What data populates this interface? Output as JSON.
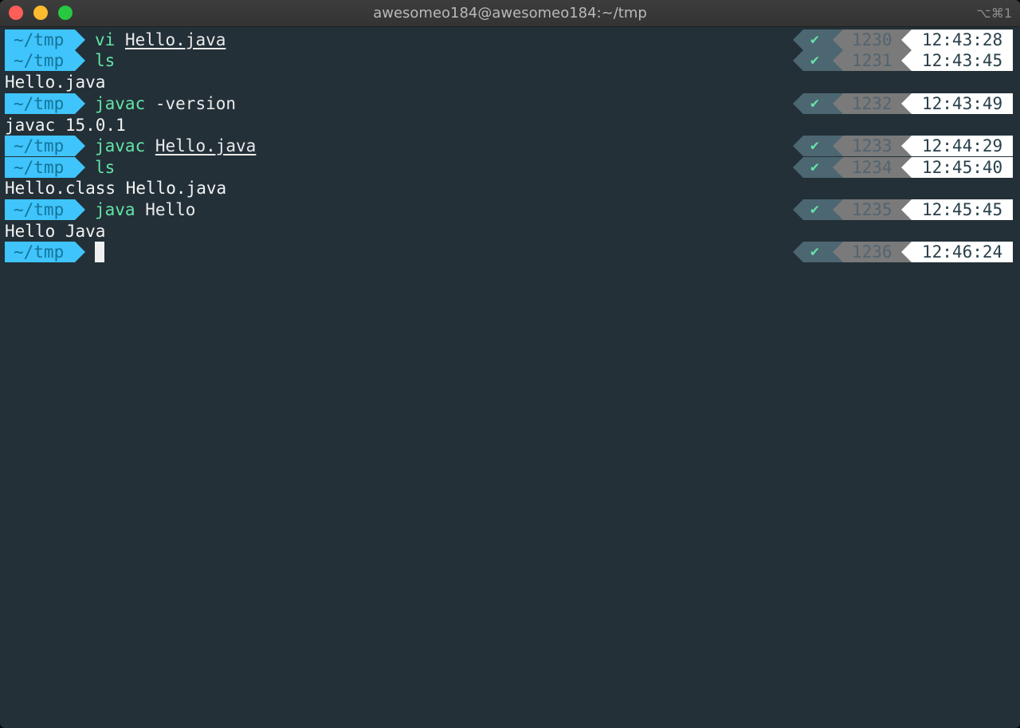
{
  "window": {
    "title": "awesomeo184@awesomeo184:~/tmp",
    "shortcut": "⌥⌘1"
  },
  "terminal": {
    "prompt_dir": "~/tmp",
    "status_mark": "✔",
    "entries": [
      {
        "cmd": "vi",
        "arg": "Hello.java",
        "num": "1230",
        "time": "12:43:28"
      },
      {
        "cmd": "ls",
        "num": "1231",
        "time": "12:43:45",
        "output": "Hello.java"
      },
      {
        "cmd": "javac",
        "arg": "-version",
        "num": "1232",
        "time": "12:43:49",
        "output": "javac 15.0.1"
      },
      {
        "cmd": "javac",
        "arg": "Hello.java",
        "num": "1233",
        "time": "12:44:29"
      },
      {
        "cmd": "ls",
        "num": "1234",
        "time": "12:45:40",
        "output": "Hello.class Hello.java"
      },
      {
        "cmd": "java",
        "arg": "Hello",
        "num": "1235",
        "time": "12:45:45",
        "output": "Hello Java"
      },
      {
        "num": "1236",
        "time": "12:46:24"
      }
    ]
  }
}
